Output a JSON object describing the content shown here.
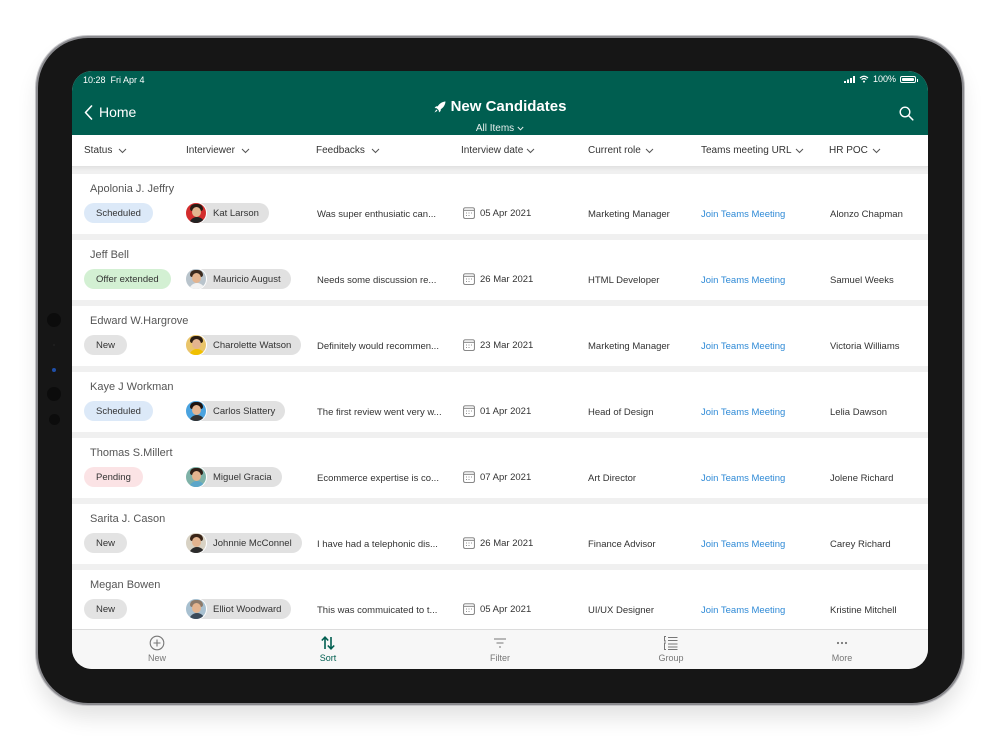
{
  "status_bar": {
    "time": "10:28",
    "date": "Fri Apr 4",
    "battery": "100%",
    "battery_level": 1.0
  },
  "header": {
    "back_label": "Home",
    "title": "New Candidates",
    "view": "All Items",
    "icons": {
      "title": "rocket-icon",
      "search": "search-icon",
      "back": "chevron-left-icon"
    }
  },
  "columns": [
    {
      "key": "status",
      "label": "Status"
    },
    {
      "key": "interviewer",
      "label": "Interviewer"
    },
    {
      "key": "feedbacks",
      "label": "Feedbacks"
    },
    {
      "key": "interview_date",
      "label": "Interview date"
    },
    {
      "key": "current_role",
      "label": "Current role"
    },
    {
      "key": "teams_url",
      "label": "Teams meeting URL"
    },
    {
      "key": "hr_poc",
      "label": "HR POC"
    }
  ],
  "status_colors": {
    "Scheduled": "#dce9f8",
    "Offer extended": "#d3f0d3",
    "New": "#e3e3e3",
    "Pending": "#fbe3e5"
  },
  "accent": "#005e50",
  "link_color": "#2f8ad6",
  "rows": [
    {
      "candidate": "Apolonia J. Jeffry",
      "status": "Scheduled",
      "interviewer": "Kat Larson",
      "feedback": "Was super enthusiatic can...",
      "date": "05 Apr 2021",
      "role": "Marketing Manager",
      "teams": "Join Teams Meeting",
      "hr": "Alonzo Chapman"
    },
    {
      "candidate": "Jeff Bell",
      "status": "Offer extended",
      "interviewer": "Mauricio August",
      "feedback": "Needs some discussion re...",
      "date": "26 Mar 2021",
      "role": "HTML Developer",
      "teams": "Join Teams Meeting",
      "hr": "Samuel Weeks"
    },
    {
      "candidate": "Edward W.Hargrove",
      "status": "New",
      "interviewer": "Charolette Watson",
      "feedback": "Definitely would recommen...",
      "date": "23 Mar 2021",
      "role": "Marketing Manager",
      "teams": "Join Teams Meeting",
      "hr": "Victoria Williams"
    },
    {
      "candidate": "Kaye J Workman",
      "status": "Scheduled",
      "interviewer": "Carlos Slattery",
      "feedback": "The first review went very w...",
      "date": "01 Apr 2021",
      "role": "Head of Design",
      "teams": "Join Teams Meeting",
      "hr": "Lelia Dawson"
    },
    {
      "candidate": "Thomas S.Millert",
      "status": "Pending",
      "interviewer": "Miguel Gracia",
      "feedback": "Ecommerce expertise is co...",
      "date": "07 Apr 2021",
      "role": "Art Director",
      "teams": "Join Teams Meeting",
      "hr": "Jolene Richard"
    },
    {
      "candidate": "Sarita J. Cason",
      "status": "New",
      "interviewer": "Johnnie McConnel",
      "feedback": "I have had a telephonic dis...",
      "date": "26 Mar 2021",
      "role": "Finance Advisor",
      "teams": "Join Teams Meeting",
      "hr": "Carey Richard"
    },
    {
      "candidate": "Megan Bowen",
      "status": "New",
      "interviewer": "Elliot Woodward",
      "feedback": "This was commuicated to t...",
      "date": "05 Apr 2021",
      "role": "UI/UX Designer",
      "teams": "Join Teams Meeting",
      "hr": "Kristine Mitchell"
    }
  ],
  "toolbar": [
    {
      "label": "New",
      "icon": "plus-circle-icon",
      "active": false
    },
    {
      "label": "Sort",
      "icon": "sort-icon",
      "active": true
    },
    {
      "label": "Filter",
      "icon": "filter-icon",
      "active": false
    },
    {
      "label": "Group",
      "icon": "group-icon",
      "active": false
    },
    {
      "label": "More",
      "icon": "more-icon",
      "active": false
    }
  ]
}
